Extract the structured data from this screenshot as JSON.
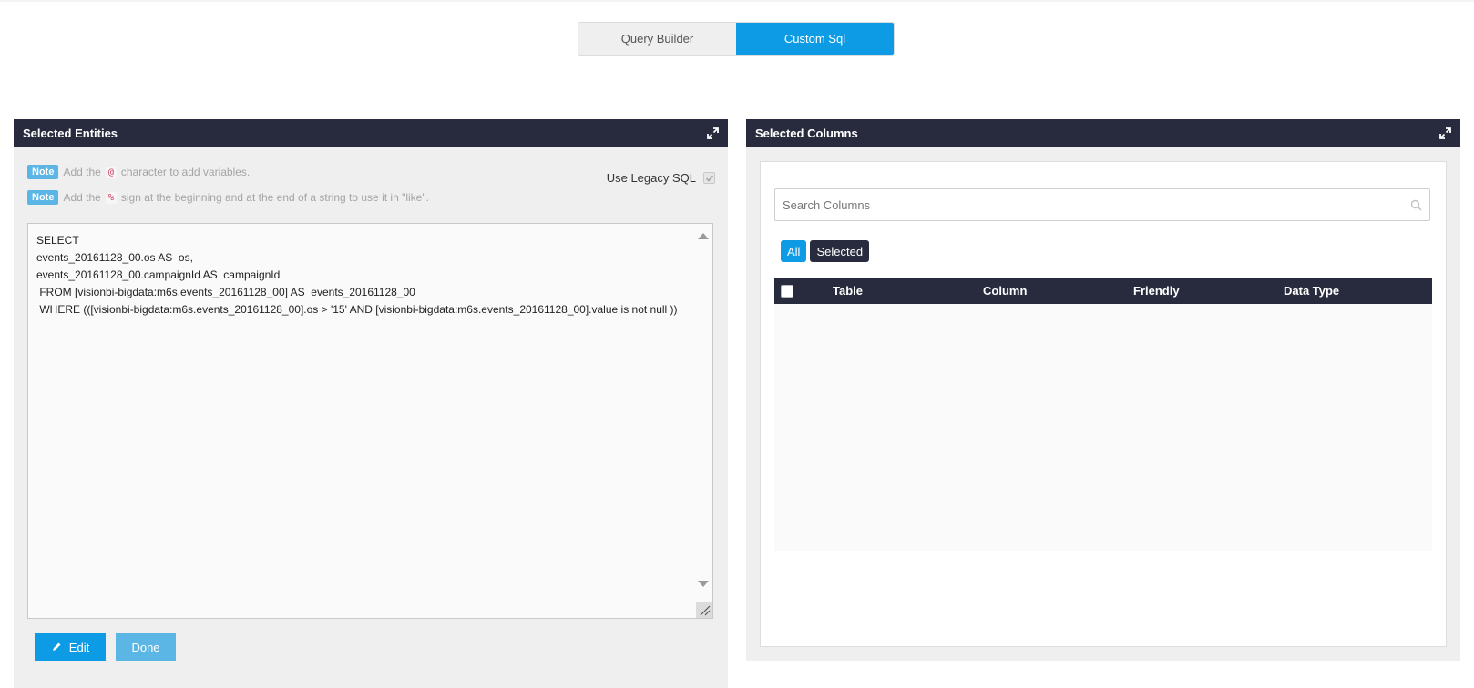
{
  "mode_toggle": {
    "query_builder": "Query Builder",
    "custom_sql": "Custom Sql",
    "active": "Custom Sql"
  },
  "left_panel": {
    "title": "Selected Entities",
    "notes": [
      {
        "badge": "Note",
        "before": "Add the",
        "code": "@",
        "after": "character to add variables."
      },
      {
        "badge": "Note",
        "before": "Add the",
        "code": "%",
        "after": "sign at the beginning and at the end of a string to use it in \"like\"."
      }
    ],
    "legacy_sql_label": "Use Legacy SQL",
    "legacy_sql_checked": true,
    "sql_text": "SELECT\nevents_20161128_00.os AS  os,\nevents_20161128_00.campaignId AS  campaignId\n FROM [visionbi-bigdata:m6s.events_20161128_00] AS  events_20161128_00\n WHERE (([visionbi-bigdata:m6s.events_20161128_00].os > '15' AND [visionbi-bigdata:m6s.events_20161128_00].value is not null ))",
    "edit_label": "Edit",
    "done_label": "Done"
  },
  "right_panel": {
    "title": "Selected Columns",
    "search": {
      "placeholder": "Search Columns",
      "value": ""
    },
    "filters": {
      "all": "All",
      "selected": "Selected"
    },
    "columns": [
      "Table",
      "Column",
      "Friendly",
      "Data Type"
    ],
    "rows": []
  },
  "colors": {
    "accent": "#0d9be6",
    "header_dark": "#282b3d",
    "note_badge": "#5bb6e6"
  }
}
